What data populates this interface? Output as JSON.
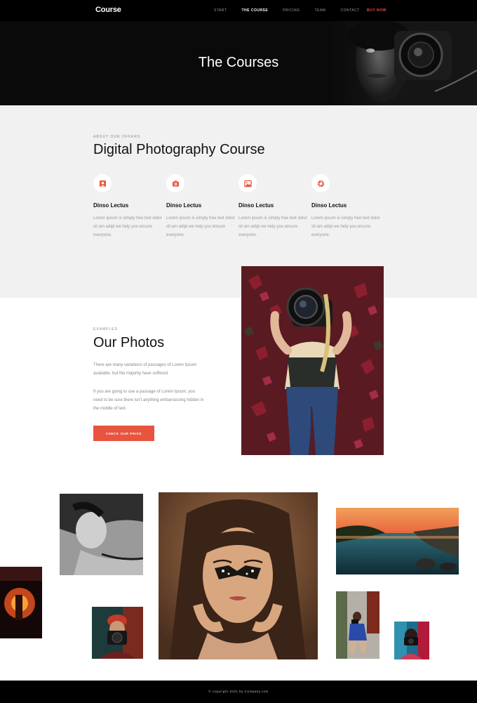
{
  "nav": {
    "logo": "Course",
    "links": [
      "START",
      "THE COURSE",
      "PRICING",
      "TEAM",
      "CONTACT"
    ],
    "active_index": 1,
    "buy": "BUY NOW"
  },
  "hero": {
    "title": "The Courses"
  },
  "offers": {
    "eyebrow": "ABOUT OUR OFFERS",
    "title": "Digital Photography Course",
    "features": [
      {
        "icon": "portrait-icon",
        "title": "Dinso Lectus",
        "text": "Lorem ipsum is simply free text dolor sit am adipi we help you ensure everyone."
      },
      {
        "icon": "camera-icon",
        "title": "Dinso Lectus",
        "text": "Lorem ipsum is simply free text dolor sit am adipi we help you ensure everyone."
      },
      {
        "icon": "image-icon",
        "title": "Dinso Lectus",
        "text": "Lorem ipsum is simply free text dolor sit am adipi we help you ensure everyone."
      },
      {
        "icon": "aperture-icon",
        "title": "Dinso Lectus",
        "text": "Lorem ipsum is simply free text dolor sit am adipi we help you ensure everyone."
      }
    ]
  },
  "photos": {
    "eyebrow": "EXAMPLES",
    "title": "Our Photos",
    "paragraph1": "There are many variations of passages of Lorem Ipsum available, but the majority have suffered.",
    "paragraph2": "If you are going to use a passage of Lorem Ipsum, you need to be sure there isn't anything embarrassing hidden in the middle of text.",
    "cta": "CHECK OUR PRICE"
  },
  "footer": {
    "text": "© copyright 2021 by Company.com"
  },
  "colors": {
    "accent": "#e8543e",
    "nav_bg": "#000000",
    "section_bg": "#f1f1f1"
  }
}
